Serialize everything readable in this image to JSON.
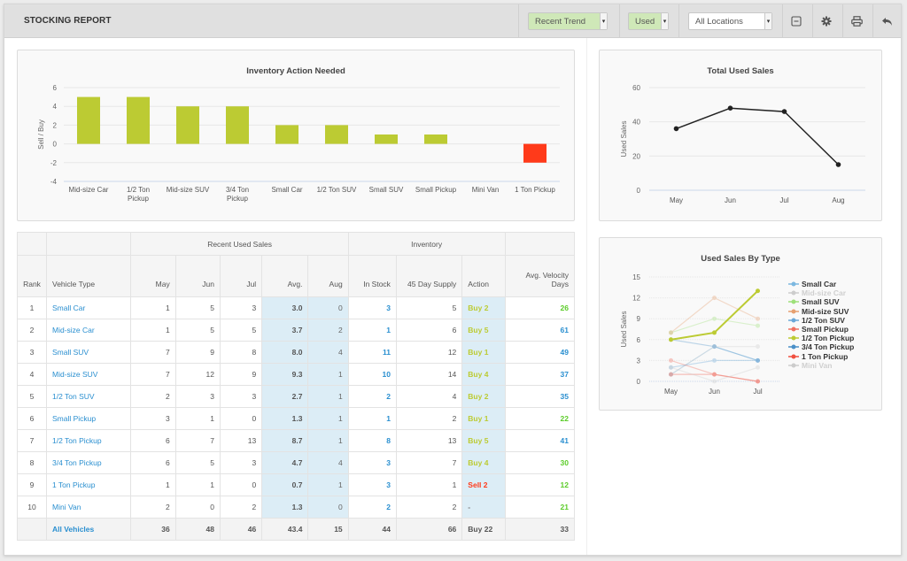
{
  "header": {
    "title": "STOCKING REPORT",
    "trend_select": "Recent Trend",
    "condition_select": "Used",
    "location_select": "All Locations",
    "icons": [
      "collapse-icon",
      "gear-icon",
      "print-icon",
      "back-icon"
    ]
  },
  "colors": {
    "buy": "#bccb33",
    "sell": "#ff3a1a",
    "link": "#2a8fd0",
    "highlight": "#dcedf6",
    "velocity_green": "#5ccc2a",
    "velocity_blue": "#2a8fd0"
  },
  "chart_data": [
    {
      "type": "bar",
      "title": "Inventory Action Needed",
      "xlabel": "",
      "ylabel": "Sell / Buy",
      "ylim": [
        -4,
        6
      ],
      "yticks": [
        6,
        4,
        2,
        0,
        -2,
        -4
      ],
      "categories": [
        "Mid-size Car",
        "1/2 Ton Pickup",
        "Mid-size SUV",
        "3/4 Ton Pickup",
        "Small Car",
        "1/2 Ton SUV",
        "Small SUV",
        "Small Pickup",
        "Mini Van",
        "1 Ton Pickup"
      ],
      "values": [
        5,
        5,
        4,
        4,
        2,
        2,
        1,
        1,
        0,
        -2
      ],
      "grid": true,
      "legend": "none"
    },
    {
      "type": "line",
      "title": "Total Used Sales",
      "xlabel": "",
      "ylabel": "Used Sales",
      "ylim": [
        0,
        60
      ],
      "yticks": [
        60,
        40,
        20,
        0
      ],
      "x": [
        "May",
        "Jun",
        "Jul",
        "Aug"
      ],
      "values": [
        36,
        48,
        46,
        15
      ],
      "grid": true,
      "legend": "none"
    },
    {
      "type": "line",
      "title": "Used Sales By Type",
      "xlabel": "",
      "ylabel": "Used Sales",
      "ylim": [
        0,
        15
      ],
      "yticks": [
        15,
        12,
        9,
        6,
        3,
        0
      ],
      "x": [
        "May",
        "Jun",
        "Jul"
      ],
      "legend": "right",
      "series": [
        {
          "name": "Small Car",
          "values": [
            1,
            5,
            3
          ],
          "color": "#7cb8e0",
          "faded": false
        },
        {
          "name": "Mid-size Car",
          "values": [
            1,
            5,
            5
          ],
          "color": "#cccccc",
          "faded": true
        },
        {
          "name": "Small SUV",
          "values": [
            7,
            9,
            8
          ],
          "color": "#9ee07a",
          "faded": false
        },
        {
          "name": "Mid-size SUV",
          "values": [
            7,
            12,
            9
          ],
          "color": "#e6a070",
          "faded": false
        },
        {
          "name": "1/2 Ton SUV",
          "values": [
            2,
            3,
            3
          ],
          "color": "#6aa8d8",
          "faded": false
        },
        {
          "name": "Small Pickup",
          "values": [
            3,
            1,
            0
          ],
          "color": "#f07060",
          "faded": false
        },
        {
          "name": "1/2 Ton Pickup",
          "values": [
            6,
            7,
            13
          ],
          "color": "#bccb33",
          "faded": false
        },
        {
          "name": "3/4 Ton Pickup",
          "values": [
            6,
            5,
            3
          ],
          "color": "#4a90c8",
          "faded": false
        },
        {
          "name": "1 Ton Pickup",
          "values": [
            1,
            1,
            0
          ],
          "color": "#f05040",
          "faded": false
        },
        {
          "name": "Mini Van",
          "values": [
            2,
            0,
            2
          ],
          "color": "#cccccc",
          "faded": true
        }
      ]
    }
  ],
  "table": {
    "group_headers": {
      "recent": "Recent Used Sales",
      "inventory": "Inventory"
    },
    "columns": [
      "Rank",
      "Vehicle Type",
      "May",
      "Jun",
      "Jul",
      "Avg.",
      "Aug",
      "In Stock",
      "45 Day Supply",
      "Action",
      "Avg. Velocity Days"
    ],
    "rows": [
      {
        "rank": "1",
        "type": "Small Car",
        "may": "1",
        "jun": "5",
        "jul": "3",
        "avg": "3.0",
        "aug": "0",
        "stock": "3",
        "supply": "5",
        "action": "Buy 2",
        "action_kind": "buy",
        "velocity": "26",
        "velocity_kind": "green"
      },
      {
        "rank": "2",
        "type": "Mid-size Car",
        "may": "1",
        "jun": "5",
        "jul": "5",
        "avg": "3.7",
        "aug": "2",
        "stock": "1",
        "supply": "6",
        "action": "Buy 5",
        "action_kind": "buy",
        "velocity": "61",
        "velocity_kind": "blue"
      },
      {
        "rank": "3",
        "type": "Small SUV",
        "may": "7",
        "jun": "9",
        "jul": "8",
        "avg": "8.0",
        "aug": "4",
        "stock": "11",
        "supply": "12",
        "action": "Buy 1",
        "action_kind": "buy",
        "velocity": "49",
        "velocity_kind": "blue"
      },
      {
        "rank": "4",
        "type": "Mid-size SUV",
        "may": "7",
        "jun": "12",
        "jul": "9",
        "avg": "9.3",
        "aug": "1",
        "stock": "10",
        "supply": "14",
        "action": "Buy 4",
        "action_kind": "buy",
        "velocity": "37",
        "velocity_kind": "blue"
      },
      {
        "rank": "5",
        "type": "1/2 Ton SUV",
        "may": "2",
        "jun": "3",
        "jul": "3",
        "avg": "2.7",
        "aug": "1",
        "stock": "2",
        "supply": "4",
        "action": "Buy 2",
        "action_kind": "buy",
        "velocity": "35",
        "velocity_kind": "blue"
      },
      {
        "rank": "6",
        "type": "Small Pickup",
        "may": "3",
        "jun": "1",
        "jul": "0",
        "avg": "1.3",
        "aug": "1",
        "stock": "1",
        "supply": "2",
        "action": "Buy 1",
        "action_kind": "buy",
        "velocity": "22",
        "velocity_kind": "green"
      },
      {
        "rank": "7",
        "type": "1/2 Ton Pickup",
        "may": "6",
        "jun": "7",
        "jul": "13",
        "avg": "8.7",
        "aug": "1",
        "stock": "8",
        "supply": "13",
        "action": "Buy 5",
        "action_kind": "buy",
        "velocity": "41",
        "velocity_kind": "blue"
      },
      {
        "rank": "8",
        "type": "3/4 Ton Pickup",
        "may": "6",
        "jun": "5",
        "jul": "3",
        "avg": "4.7",
        "aug": "4",
        "stock": "3",
        "supply": "7",
        "action": "Buy 4",
        "action_kind": "buy",
        "velocity": "30",
        "velocity_kind": "green"
      },
      {
        "rank": "9",
        "type": "1 Ton Pickup",
        "may": "1",
        "jun": "1",
        "jul": "0",
        "avg": "0.7",
        "aug": "1",
        "stock": "3",
        "supply": "1",
        "action": "Sell 2",
        "action_kind": "sell",
        "velocity": "12",
        "velocity_kind": "green"
      },
      {
        "rank": "10",
        "type": "Mini Van",
        "may": "2",
        "jun": "0",
        "jul": "2",
        "avg": "1.3",
        "aug": "0",
        "stock": "2",
        "supply": "2",
        "action": "-",
        "action_kind": "none",
        "velocity": "21",
        "velocity_kind": "green"
      }
    ],
    "total": {
      "label": "All Vehicles",
      "may": "36",
      "jun": "48",
      "jul": "46",
      "avg": "43.4",
      "aug": "15",
      "stock": "44",
      "supply": "66",
      "action": "Buy 22",
      "velocity": "33"
    }
  }
}
